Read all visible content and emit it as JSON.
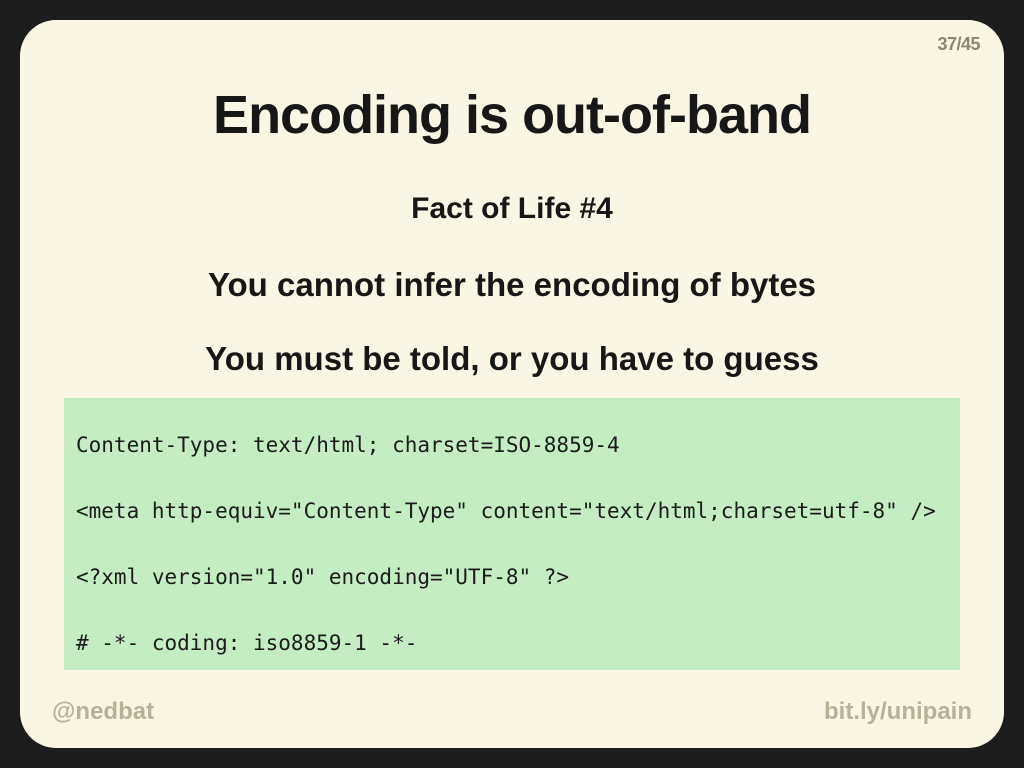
{
  "page": {
    "current": 37,
    "total": 45,
    "display": "37/45"
  },
  "title": "Encoding is out-of-band",
  "subtitle": "Fact of Life #4",
  "line1": "You cannot infer the encoding of bytes",
  "line2": "You must be told, or you have to guess",
  "code": {
    "l1": "Content-Type: text/html; charset=ISO-8859-4",
    "l2": "<meta http-equiv=\"Content-Type\" content=\"text/html;charset=utf-8\" />",
    "l3": "<?xml version=\"1.0\" encoding=\"UTF-8\" ?>",
    "l4": "# -*- coding: iso8859-1 -*-"
  },
  "footer": {
    "left": "@nedbat",
    "right": "bit.ly/unipain"
  }
}
